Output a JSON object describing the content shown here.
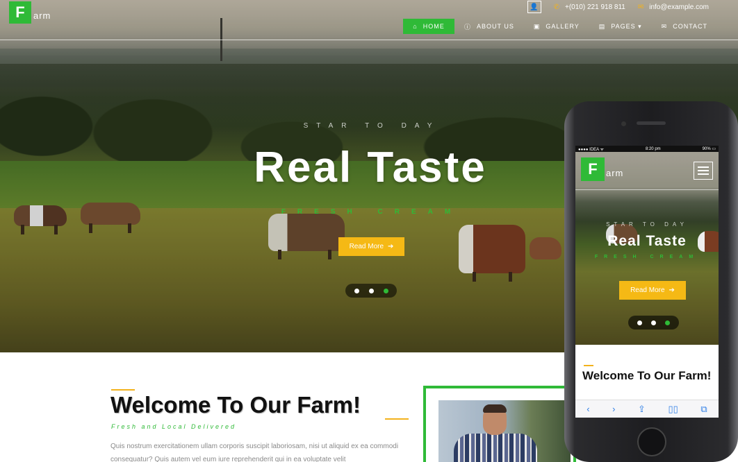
{
  "site": {
    "logo_letter": "F",
    "logo_text": "arm"
  },
  "topbar": {
    "user_icon": "user-icon",
    "phone": "+(010) 221 918 811",
    "phone_icon": "phone-icon",
    "email": "info@example.com",
    "email_icon": "envelope-icon"
  },
  "nav": {
    "items": [
      {
        "label": "HOME",
        "icon": "home-icon",
        "glyph": "⌂"
      },
      {
        "label": "ABOUT US",
        "icon": "info-icon",
        "glyph": "ⓘ"
      },
      {
        "label": "GALLERY",
        "icon": "image-icon",
        "glyph": "▣"
      },
      {
        "label": "PAGES",
        "icon": "file-icon",
        "glyph": "▤",
        "caret": "▾"
      },
      {
        "label": "CONTACT",
        "icon": "envelope-icon",
        "glyph": "✉"
      }
    ]
  },
  "hero": {
    "kicker": "STAR TO DAY",
    "headline": "Real Taste",
    "subheadline": "FRESH CREAM",
    "cta_label": "Read More",
    "cta_icon": "arrow-right-icon",
    "slide_count": 3,
    "active_slide": 3
  },
  "welcome": {
    "title": "Welcome To Our Farm!",
    "tagline": "Fresh and Local Delivered",
    "body": "Quis nostrum exercitationem ullam corporis suscipit laboriosam, nisi ut aliquid ex ea commodi consequatur? Quis autem vel eum iure reprehenderit qui in ea voluptate velit"
  },
  "mobile": {
    "status_carrier": "●●●● IDEA ᯤ",
    "status_time": "8:20 pm",
    "status_battery": "90% ▭",
    "logo_letter": "F",
    "logo_text": "arm",
    "kicker": "STAR TO DAY",
    "headline": "Real Taste",
    "subheadline": "FRESH CREAM",
    "cta_label": "Read More",
    "welcome_title": "Welcome To Our Farm!",
    "toolbar": [
      "‹",
      "›",
      "⇪",
      "▯▯",
      "⧉"
    ]
  },
  "colors": {
    "brand_green": "#2fba37",
    "accent_yellow": "#f5b915"
  }
}
